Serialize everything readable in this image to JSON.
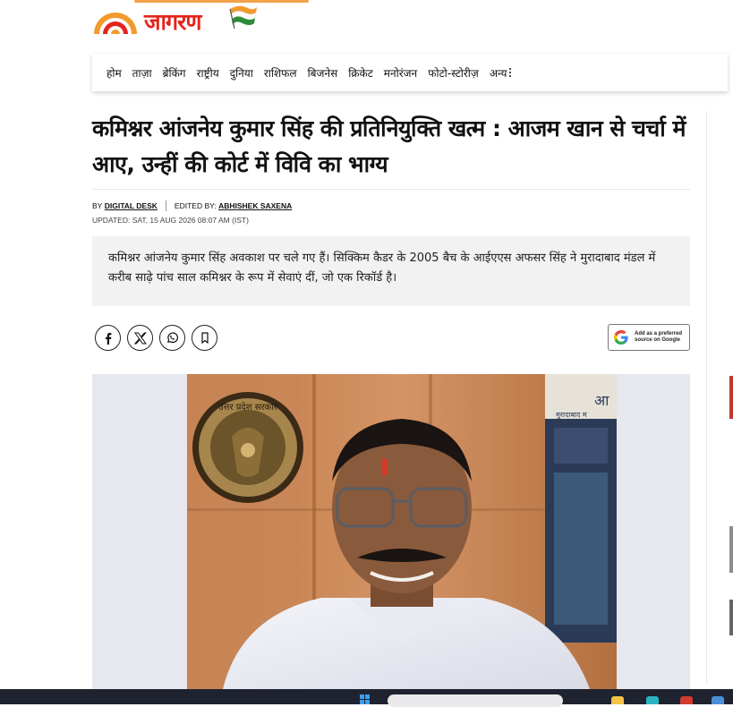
{
  "brand": {
    "name": "जागरण",
    "colors": {
      "red": "#e4241b",
      "orange": "#f29a2e",
      "green": "#2e8b3a"
    }
  },
  "nav": {
    "items": [
      "होम",
      "ताज़ा",
      "ब्रेकिंग",
      "राष्ट्रीय",
      "दुनिया",
      "राशिफल",
      "बिजनेस",
      "क्रिकेट",
      "मनोरंजन",
      "फोटो-स्टोरीज़"
    ],
    "more_label": "अन्य"
  },
  "article": {
    "headline": "कमिश्नर आंजनेय कुमार सिंह की प्रतिनियुक्ति खत्म : आजम खान से चर्चा में आए, उन्हीं की कोर्ट में विवि का भाग्य",
    "byline": {
      "by_prefix": "BY",
      "author": "DIGITAL DESK",
      "edited_prefix": "EDITED BY:",
      "editor": "ABHISHEK SAXENA"
    },
    "updated": "UPDATED: SAT, 15 AUG 2026 08:07 AM (IST)",
    "summary": "कमिश्नर आंजनेय कुमार सिंह अवकाश पर चले गए हैं। सिक्किम कैडर के 2005 बैच के आईएएस अफसर सिंह ने मुरादाबाद मंडल में करीब साढ़े पांच साल कमिश्नर के रूप में सेवाएं दीं, जो एक रिकॉर्ड है।"
  },
  "share": {
    "buttons": [
      "facebook-icon",
      "x-icon",
      "whatsapp-icon",
      "bookmark-icon"
    ],
    "google_badge_line1": "Add as a preferred",
    "google_badge_line2": "source on Google"
  },
  "photo": {
    "emblem_text": "उत्तर प्रदेश सरकार",
    "board_text": "आ",
    "board_sub": "मुरादाबाद म"
  }
}
